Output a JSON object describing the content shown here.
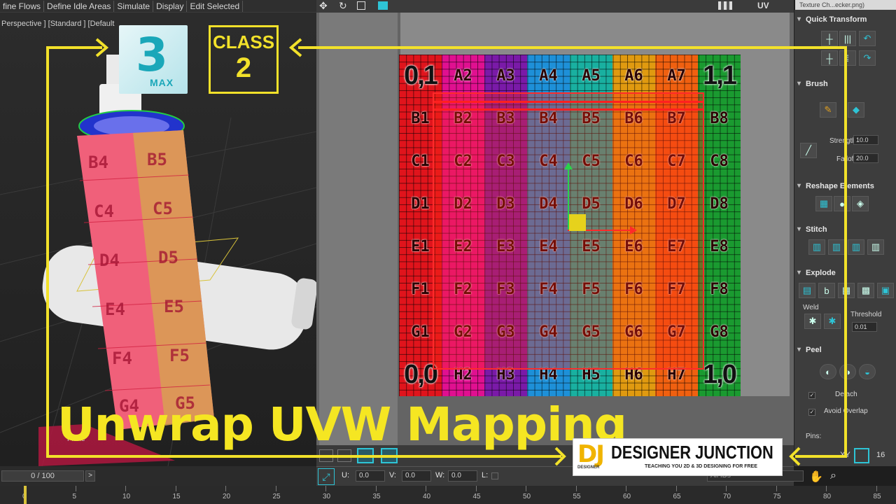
{
  "menu": {
    "items": [
      "fine Flows",
      "Define Idle Areas",
      "Simulate",
      "Display",
      "Edit Selected"
    ]
  },
  "viewport": {
    "label": "Perspective ] [Standard ] [Default",
    "plane_label": "Plane"
  },
  "logos": {
    "max_number": "3",
    "max_text": "MAX",
    "class_word": "CLASS",
    "class_number": "2"
  },
  "title": "Unwrap UVW Mapping",
  "brand": {
    "initials": "DJ",
    "initials_sub": "DESIGNER",
    "name": "DESIGNER JUNCTION",
    "tagline": "TEACHING YOU 2D & 3D DESIGNING FOR FREE"
  },
  "uv_editor": {
    "texture_label": "Texture Ch...ecker.png)",
    "uv_label": "UV",
    "checker_rows": [
      [
        "0,1",
        "A2",
        "A3",
        "A4",
        "A5",
        "A6",
        "A7",
        "1,1"
      ],
      [
        "B1",
        "B2",
        "B3",
        "B4",
        "B5",
        "B6",
        "B7",
        "B8"
      ],
      [
        "C1",
        "C2",
        "C3",
        "C4",
        "C5",
        "C6",
        "C7",
        "C8"
      ],
      [
        "D1",
        "D2",
        "D3",
        "D4",
        "D5",
        "D6",
        "D7",
        "D8"
      ],
      [
        "E1",
        "E2",
        "E3",
        "E4",
        "E5",
        "E6",
        "E7",
        "E8"
      ],
      [
        "F1",
        "F2",
        "F3",
        "F4",
        "F5",
        "F6",
        "F7",
        "F8"
      ],
      [
        "G1",
        "G2",
        "G3",
        "G4",
        "G5",
        "G6",
        "G7",
        "G8"
      ],
      [
        "0,0",
        "H2",
        "H3",
        "H4",
        "H5",
        "H6",
        "H7",
        "1,0"
      ]
    ],
    "column_colors": [
      "#e0141c",
      "#e01090",
      "#7a1aa8",
      "#1e90d8",
      "#19b0a0",
      "#e09a10",
      "#f06010",
      "#1a9a30"
    ]
  },
  "bottle_labels": [
    "B4",
    "B5",
    "C4",
    "C5",
    "D4",
    "D5",
    "E4",
    "E5",
    "F4",
    "F5",
    "G4",
    "G5"
  ],
  "panel": {
    "quick_transform": "Quick Transform",
    "brush": "Brush",
    "strength_label": "Strength:",
    "strength_value": "10.0",
    "falloff_label": "Falloff:",
    "falloff_value": "20.0",
    "reshape": "Reshape Elements",
    "stitch": "Stitch",
    "explode": "Explode",
    "weld": "Weld",
    "threshold_label": "Threshold",
    "threshold_value": "0.01",
    "peel": "Peel",
    "detach": "Detach",
    "avoid_overlap": "Avoid Overlap",
    "pins": "Pins:"
  },
  "status": {
    "frame": "0 / 100",
    "next": ">",
    "u_label": "U:",
    "u_value": "0.0",
    "v_label": "V:",
    "v_value": "0.0",
    "w_label": "W:",
    "w_value": "0.0",
    "l_label": "L:",
    "ids_label": "All IDs",
    "xy_label": "XY",
    "count": "16"
  },
  "timeline": {
    "ticks": [
      "0",
      "5",
      "10",
      "15",
      "20",
      "25",
      "30",
      "35",
      "40",
      "45",
      "50",
      "55",
      "60",
      "65",
      "70",
      "75",
      "80",
      "85"
    ]
  },
  "colors": {
    "accent_yellow": "#f2e12a",
    "uv_red": "#ff2a2a",
    "teal": "#2ec4d6"
  }
}
